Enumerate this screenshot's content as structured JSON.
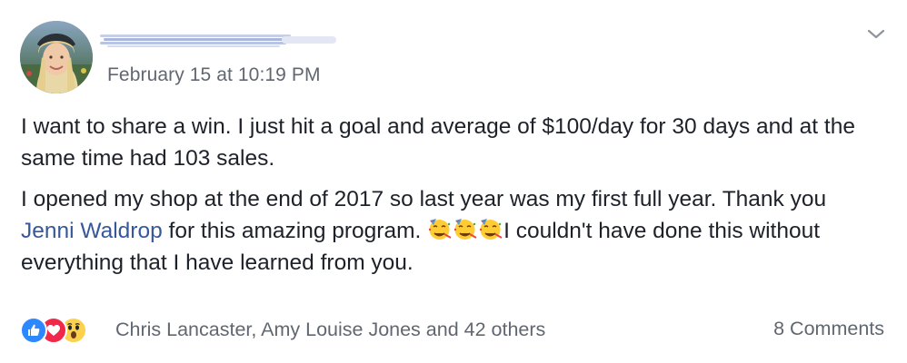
{
  "post": {
    "author": {
      "name": "",
      "avatar_icon": "profile-photo"
    },
    "timestamp": "February 15 at 10:19 PM",
    "menu_icon": "chevron-down-icon",
    "paragraph1": "I want to share a win. I just hit a goal and average of $100/day for 30 days and at the same time had 103 sales.",
    "paragraph2_before": "I opened my shop at the end of 2017 so last year was my first full year. Thank you ",
    "mention": "Jenni Waldrop",
    "paragraph2_middle": " for this amazing program. ",
    "emoji_icon": "partying-face-emoji",
    "paragraph2_after": "I couldn't have done this without everything that I have learned from you.",
    "reactions": {
      "icons": [
        "like-icon",
        "love-icon",
        "wow-icon"
      ],
      "summary": "Chris Lancaster, Amy Louise Jones and 42 others"
    },
    "comments": "8 Comments"
  },
  "colors": {
    "text": "#1d2129",
    "secondary": "#616770",
    "link": "#365899",
    "like": "#2d88ff",
    "love": "#f0284a",
    "wow": "#fcd14d"
  }
}
